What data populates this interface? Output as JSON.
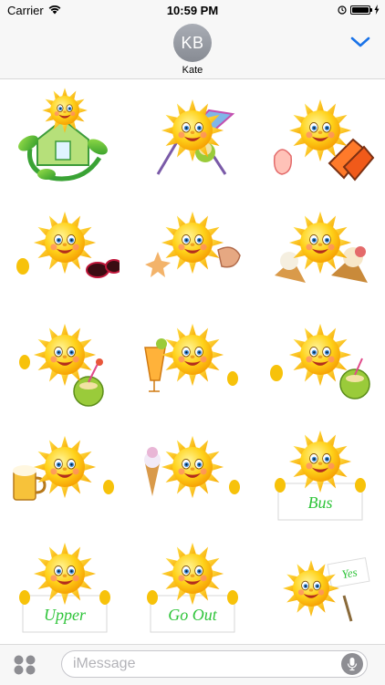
{
  "status_bar": {
    "carrier": "Carrier",
    "time": "10:59 PM",
    "battery_level": 1.0
  },
  "header": {
    "avatar_initials": "KB",
    "contact_name": "Kate",
    "accent_color": "#1a73e8"
  },
  "stickers": [
    {
      "name": "eco-house-sun-sticker",
      "icon": "sun-house-leaves"
    },
    {
      "name": "sun-beach-chair-sticker",
      "icon": "sun-deckchair-coconut"
    },
    {
      "name": "sun-flippers-sticker",
      "icon": "sun-flippers-snorkel"
    },
    {
      "name": "sun-sunglasses-sticker",
      "icon": "sun-thumbs-up-sunglasses"
    },
    {
      "name": "sun-seashells-sticker",
      "icon": "sun-starfish-shell"
    },
    {
      "name": "sun-ice-cream-sticker",
      "icon": "sun-ice-cream-cones"
    },
    {
      "name": "sun-coconut-drink-sticker",
      "icon": "sun-coconut-cocktail"
    },
    {
      "name": "sun-cocktail-sticker",
      "icon": "sun-orange-cocktail"
    },
    {
      "name": "sun-coconut-thumbs-sticker",
      "icon": "sun-thumbs-coconut"
    },
    {
      "name": "sun-beer-sticker",
      "icon": "sun-beer-mug"
    },
    {
      "name": "sun-ice-cream-cone-sticker",
      "icon": "sun-ice-cream-cone"
    },
    {
      "name": "sun-bus-sign-sticker",
      "icon": "sun-sign",
      "sign_text": "Bus"
    },
    {
      "name": "sun-upper-sign-sticker",
      "icon": "sun-sign",
      "sign_text": "Upper"
    },
    {
      "name": "sun-go-out-sign-sticker",
      "icon": "sun-sign",
      "sign_text": "Go Out"
    },
    {
      "name": "sun-yes-sign-sticker",
      "icon": "sun-sign",
      "sign_text": "Yes"
    }
  ],
  "input": {
    "placeholder": "iMessage"
  }
}
